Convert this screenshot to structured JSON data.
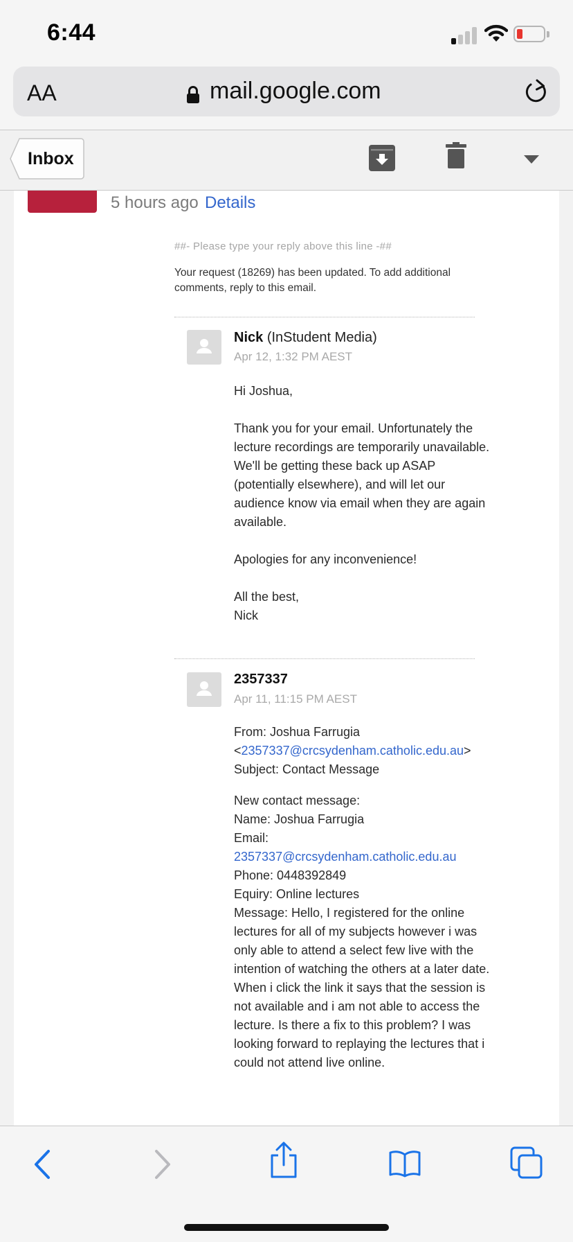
{
  "status_bar": {
    "time": "6:44"
  },
  "browser": {
    "url": "mail.google.com",
    "text_size_label": "AA"
  },
  "toolbar": {
    "back_label": "Inbox"
  },
  "message_header": {
    "time_ago": "5 hours ago",
    "details_label": "Details"
  },
  "ticket": {
    "reply_line": "##- Please type your reply above this line -##",
    "update_note": "Your request (18269) has been updated. To add additional comments, reply to this email."
  },
  "comments": [
    {
      "author_name": "Nick",
      "author_org": "(InStudent Media)",
      "timestamp": "Apr 12, 1:32 PM AEST",
      "greeting": "Hi Joshua,",
      "paragraph1": "Thank you for your email. Unfortunately the lecture recordings are temporarily unavailable. We'll be getting these back up ASAP (potentially elsewhere), and will let our audience know via email when they are again available.",
      "paragraph2": "Apologies for any inconvenience!",
      "signoff": "All the best,",
      "signature": "Nick"
    },
    {
      "author_name": "2357337",
      "timestamp": "Apr 11, 11:15 PM AEST",
      "from_prefix": "From: Joshua Farrugia",
      "from_email": "2357337@crcsydenham.catholic.edu.au",
      "subject": "Subject: Contact Message",
      "new_contact": "New contact message:",
      "name_line": "Name: Joshua Farrugia",
      "email_label": "Email:",
      "email_value": "2357337@crcsydenham.catholic.edu.au",
      "phone_line": "Phone: 0448392849",
      "enquiry_line": "Equiry: Online lectures",
      "message_line": "Message: Hello, I registered for the online lectures for all of my subjects however i was only able to attend a select few live with the intention of watching the others at a later date. When i click the link it says that the session is not available and i am not able to access the lecture. Is there a fix to this problem? I was looking forward to replaying the lectures that i could not attend live online."
    }
  ],
  "colors": {
    "link": "#3366cc",
    "badge": "#b7213c",
    "safari_blue": "#1a73e8",
    "battery_low": "#e8352e"
  },
  "icons": {
    "toolbar": [
      "archive-icon",
      "trash-icon",
      "chevron-down-icon"
    ],
    "bottom_bar": [
      "back-arrow-icon",
      "forward-arrow-icon",
      "share-icon",
      "bookmarks-icon",
      "tabs-icon"
    ]
  }
}
